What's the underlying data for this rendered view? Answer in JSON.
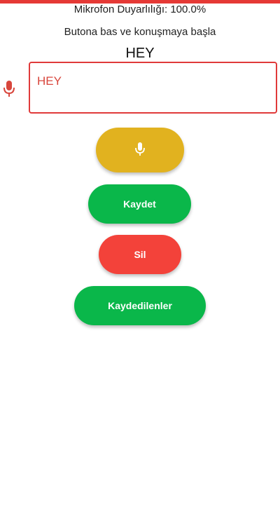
{
  "header": {
    "mic_sensitivity": "Mikrofon Duyarlılığı: 100.0%",
    "instruction": "Butona bas ve konuşmaya başla",
    "recognized_text": "HEY"
  },
  "text_field": {
    "value": "HEY",
    "prefix_icon": "mic-icon"
  },
  "buttons": {
    "mic_icon": "mic-icon",
    "save_label": "Kaydet",
    "delete_label": "Sil",
    "saved_label": "Kaydedilenler"
  },
  "colors": {
    "accent_red": "#e53935",
    "mic_button": "#e1b21f",
    "green_button": "#0ab74a",
    "red_button": "#f3423a",
    "field_border": "#e03a3a"
  }
}
